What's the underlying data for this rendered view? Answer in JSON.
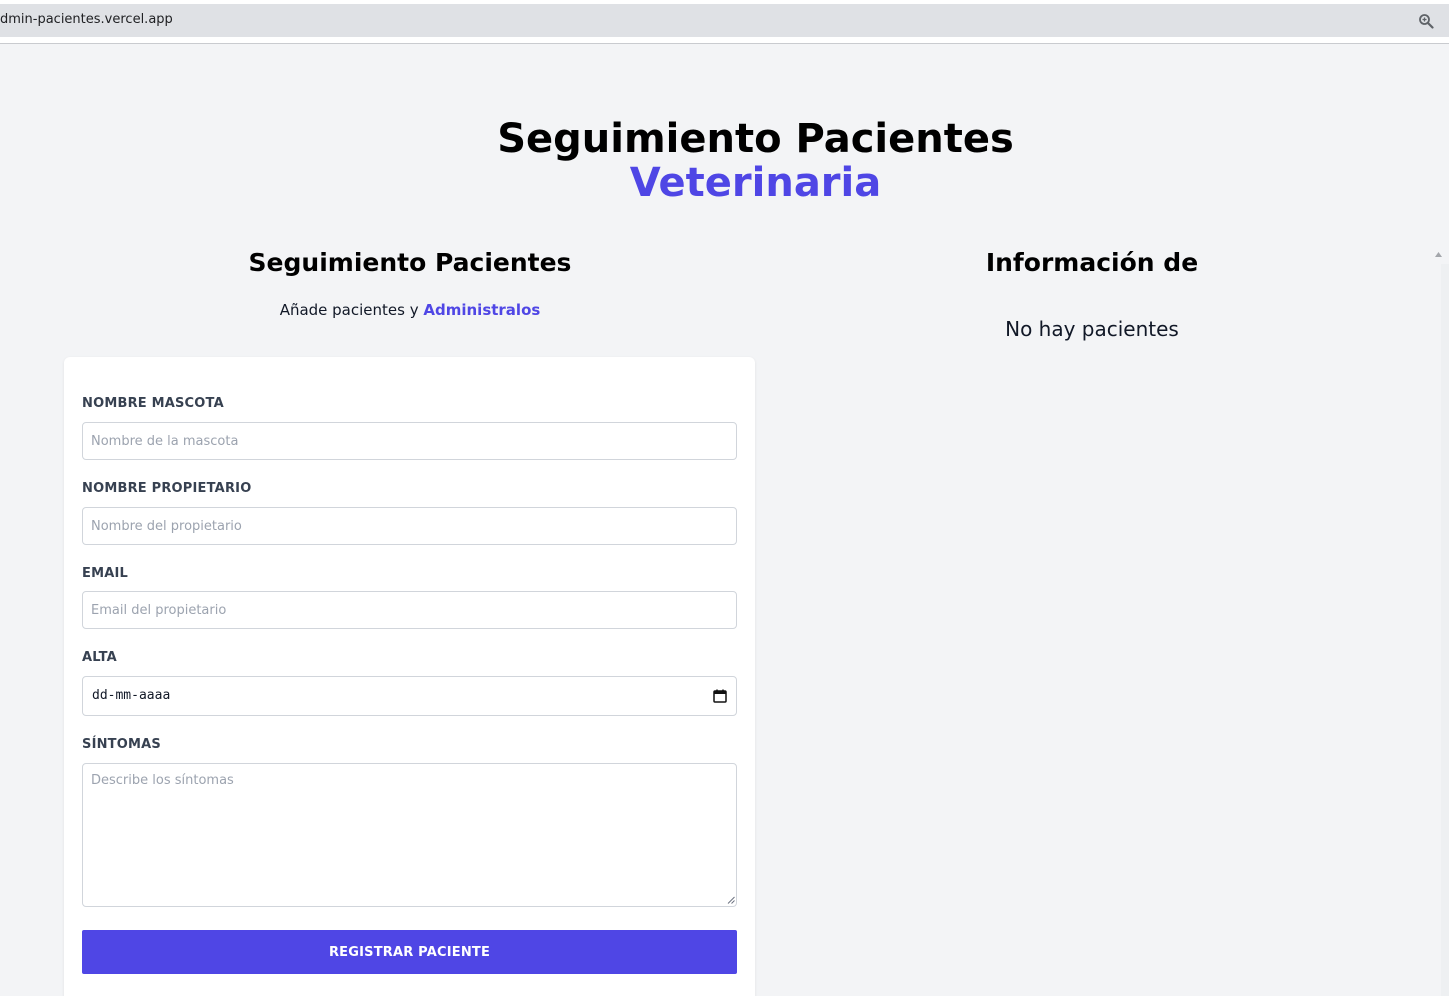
{
  "browser": {
    "url": "dmin-pacientes.vercel.app"
  },
  "header": {
    "title_line1": "Seguimiento Pacientes",
    "title_line2": "Veterinaria"
  },
  "form_section": {
    "heading": "Seguimiento Pacientes",
    "subtitle_prefix": "Añade pacientes y ",
    "subtitle_accent": "Administralos"
  },
  "list_section": {
    "heading": "Información de",
    "empty_message": "No hay pacientes"
  },
  "form": {
    "pet_name_label": "NOMBRE MASCOTA",
    "pet_name_placeholder": "Nombre de la mascota",
    "owner_label": "NOMBRE PROPIETARIO",
    "owner_placeholder": "Nombre del propietario",
    "email_label": "EMAIL",
    "email_placeholder": "Email del propietario",
    "discharge_label": "ALTA",
    "discharge_value": "dd-mm-aaaa",
    "symptoms_label": "SÍNTOMAS",
    "symptoms_placeholder": "Describe los síntomas",
    "submit_label": "REGISTRAR PACIENTE"
  },
  "icons": {
    "zoom": "zoom-icon",
    "calendar": "calendar-icon"
  },
  "colors": {
    "accent": "#4f46e5",
    "page_background": "#f3f4f6",
    "card_background": "#ffffff"
  }
}
